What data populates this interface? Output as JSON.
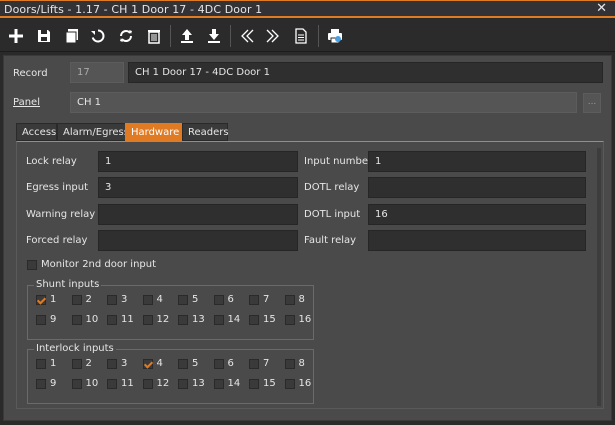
{
  "window": {
    "title": "Doors/Lifts - 1.17 - CH 1 Door 17 - 4DC Door 1",
    "close": "✕"
  },
  "toolbar": {
    "buttons": [
      "add-icon",
      "save-icon",
      "copy-icon",
      "undo-icon",
      "refresh-icon",
      "delete-icon",
      "upload-icon",
      "download-icon",
      "previous-icon",
      "next-icon",
      "report-icon",
      "print-icon"
    ]
  },
  "record": {
    "label": "Record",
    "id": "17",
    "name": "CH 1 Door 17 - 4DC Door 1"
  },
  "panel": {
    "label": "Panel",
    "value": "CH 1",
    "browse": "..."
  },
  "tabs": [
    {
      "label": "Access",
      "active": false
    },
    {
      "label": "Alarm/Egress",
      "active": false
    },
    {
      "label": "Hardware",
      "active": true
    },
    {
      "label": "Readers",
      "active": false
    }
  ],
  "hardware": {
    "left": [
      {
        "label": "Lock relay",
        "value": "1"
      },
      {
        "label": "Egress input",
        "value": "3"
      },
      {
        "label": "Warning relay",
        "value": ""
      },
      {
        "label": "Forced relay",
        "value": ""
      }
    ],
    "right": [
      {
        "label": "Input number",
        "value": "1"
      },
      {
        "label": "DOTL relay",
        "value": ""
      },
      {
        "label": "DOTL input",
        "value": "16"
      },
      {
        "label": "Fault relay",
        "value": ""
      }
    ],
    "monitor_2nd_door": {
      "label": "Monitor 2nd door input",
      "checked": false
    },
    "shunt": {
      "title": "Shunt inputs",
      "items": [
        "1",
        "2",
        "3",
        "4",
        "5",
        "6",
        "7",
        "8",
        "9",
        "10",
        "11",
        "12",
        "13",
        "14",
        "15",
        "16"
      ],
      "checked": [
        "1"
      ]
    },
    "interlock": {
      "title": "Interlock inputs",
      "items": [
        "1",
        "2",
        "3",
        "4",
        "5",
        "6",
        "7",
        "8",
        "9",
        "10",
        "11",
        "12",
        "13",
        "14",
        "15",
        "16"
      ],
      "checked": [
        "4"
      ]
    }
  }
}
